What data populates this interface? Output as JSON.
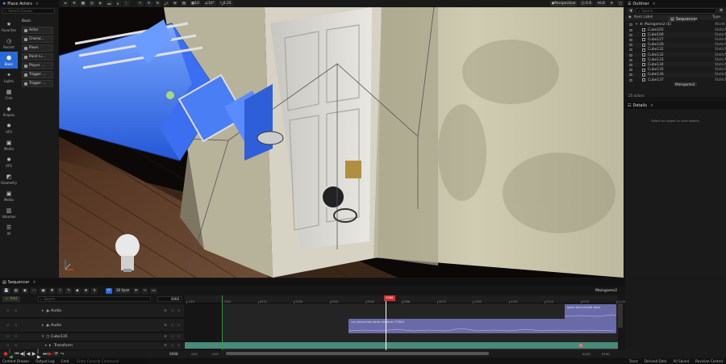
{
  "place_actors": {
    "title": "Place Actors",
    "search_placeholder": "Search Classes",
    "group_title": "Basic",
    "categories": [
      {
        "icon": "star-icon",
        "label": "Favorites"
      },
      {
        "icon": "clock-icon",
        "label": "Recent"
      },
      {
        "icon": "basic-icon",
        "label": "Basic"
      },
      {
        "icon": "light-icon",
        "label": "Lights"
      },
      {
        "icon": "cinematic-icon",
        "label": "Cine"
      },
      {
        "icon": "shapes-icon",
        "label": "Shapes"
      },
      {
        "icon": "vfx-icon",
        "label": "VFX"
      },
      {
        "icon": "media-icon",
        "label": "Media"
      },
      {
        "icon": "vfx-icon",
        "label": "VFX"
      },
      {
        "icon": "geometry-icon",
        "label": "Geometry"
      },
      {
        "icon": "media-icon",
        "label": "Media"
      },
      {
        "icon": "volumes-icon",
        "label": "Volumes"
      },
      {
        "icon": "all-icon",
        "label": "All"
      }
    ],
    "items": [
      "Actor",
      "Charac...",
      "Pawn",
      "Point Li...",
      "Player ...",
      "Trigger ...",
      "Trigger ..."
    ]
  },
  "viewport": {
    "mode": "Perspective",
    "lit": "Lit",
    "fov": "90°",
    "speed": "0.6",
    "snap": "10",
    "angle": "10°",
    "scale": "0.25"
  },
  "outliner": {
    "title": "Outliner",
    "sequencer_tab": "Sequencer",
    "search_placeholder": "Search...",
    "col_label": "Item Label",
    "col_type": "Type",
    "root": {
      "name": "Maingame2 (E)",
      "type": "World"
    },
    "rows": [
      {
        "name": "Cube105",
        "type": "StaticM"
      },
      {
        "name": "Cube106",
        "type": "StaticM"
      },
      {
        "name": "Cube127",
        "type": "StaticM"
      },
      {
        "name": "Cube128",
        "type": "StaticM"
      },
      {
        "name": "Cube131",
        "type": "StaticM"
      },
      {
        "name": "Cube132",
        "type": "StaticM"
      },
      {
        "name": "Cube133",
        "type": "StaticM"
      },
      {
        "name": "Cube134",
        "type": "StaticM"
      },
      {
        "name": "Cube135",
        "type": "StaticM"
      },
      {
        "name": "Cube136",
        "type": "StaticM"
      },
      {
        "name": "Cube137",
        "type": "StaticM"
      }
    ],
    "tooltip": "Maingame2",
    "count": "25 actors"
  },
  "details": {
    "title": "Details",
    "empty": "Select an object to view details."
  },
  "sequencer": {
    "title": "Sequencer",
    "fps": "30 fps",
    "sequence_name": "Maingame2",
    "add_label": "+ Add",
    "search_placeholder": "Search",
    "tracks": [
      "Audio",
      "Audio",
      "Cube135",
      "Transform"
    ],
    "current_frame": "0068",
    "start_frame": "-015",
    "start_frame2": "-015",
    "end_frame": "0150",
    "end_frame2": "0150",
    "frame_readout": "0068",
    "sections": [
      {
        "label": "open-and-closed-door",
        "start": 0.88,
        "end": 1.0,
        "track": 0
      },
      {
        "label": "car_keys-man-and-creature-77504",
        "start": 0.38,
        "end": 1.0,
        "track": 1
      }
    ],
    "ticks": [
      "-015",
      "0000",
      "0015",
      "0030",
      "0045",
      "0060",
      "0068",
      "0075",
      "0090",
      "0105",
      "0120",
      "0135",
      "0150"
    ],
    "playhead": 0.465
  },
  "status": [
    "Content Drawer",
    "Output Log",
    "Cmd",
    "Enter Console Command",
    "Trace",
    "Derived Data",
    "All Saved",
    "Revision Control"
  ]
}
